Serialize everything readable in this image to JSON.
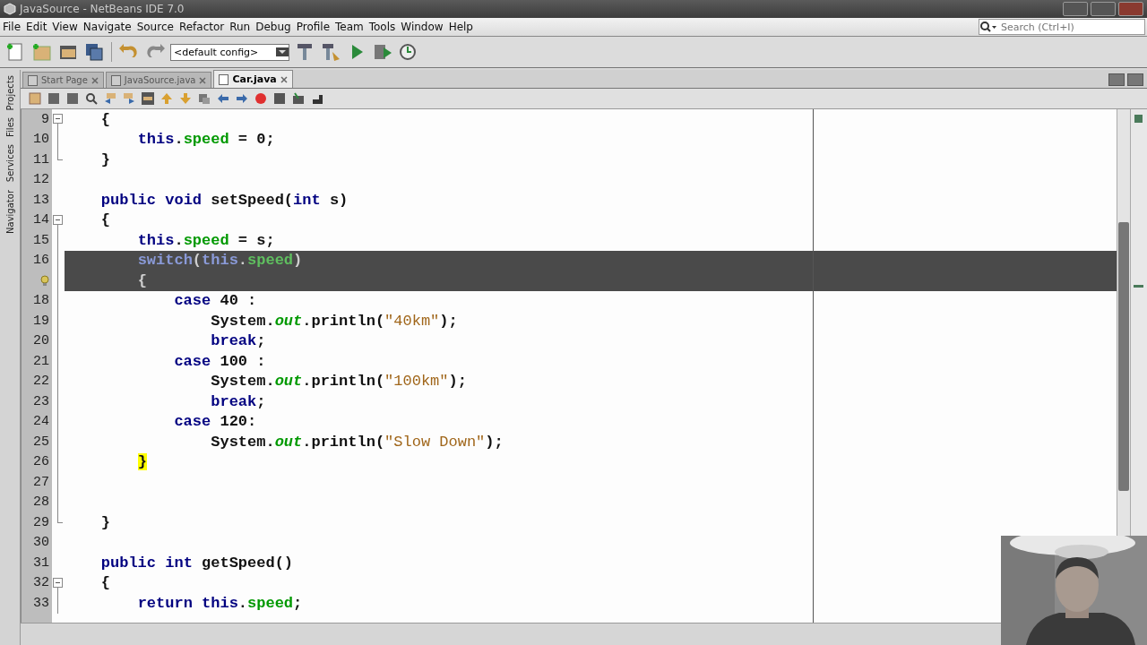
{
  "window": {
    "title": "JavaSource - NetBeans IDE 7.0"
  },
  "menu": [
    "File",
    "Edit",
    "View",
    "Navigate",
    "Source",
    "Refactor",
    "Run",
    "Debug",
    "Profile",
    "Team",
    "Tools",
    "Window",
    "Help"
  ],
  "search": {
    "placeholder": "Search (Ctrl+I)"
  },
  "toolbar": {
    "config": "<default config>"
  },
  "side_tabs": [
    "Projects",
    "Files",
    "Services",
    "Navigator"
  ],
  "editor_tabs": [
    {
      "label": "Start Page",
      "selected": false
    },
    {
      "label": "JavaSource.java",
      "selected": false
    },
    {
      "label": "Car.java",
      "selected": true
    }
  ],
  "code_lines": [
    {
      "number": "9",
      "kind": "fold_start",
      "selected": false,
      "tokens": [
        {
          "text": "    {",
          "kind": "plain"
        }
      ]
    },
    {
      "number": "10",
      "kind": "code",
      "selected": false,
      "tokens": [
        {
          "text": "        this",
          "kind": "keyword"
        },
        {
          "text": ".",
          "kind": "plain"
        },
        {
          "text": "speed",
          "kind": "field"
        },
        {
          "text": " = 0;",
          "kind": "plain"
        }
      ]
    },
    {
      "number": "11",
      "kind": "fold_end",
      "selected": false,
      "tokens": [
        {
          "text": "    }",
          "kind": "plain"
        }
      ]
    },
    {
      "number": "12",
      "kind": "code",
      "selected": false
    },
    {
      "number": "13",
      "kind": "code",
      "selected": false,
      "tokens": [
        {
          "text": "    public",
          "kind": "keyword"
        },
        {
          "text": " void",
          "kind": "keyword"
        },
        {
          "text": " setSpeed(",
          "kind": "plain"
        },
        {
          "text": "int",
          "kind": "keyword"
        },
        {
          "text": " s)",
          "kind": "plain"
        }
      ]
    },
    {
      "number": "14",
      "kind": "fold_start",
      "selected": false,
      "tokens": [
        {
          "text": "    {",
          "kind": "plain"
        }
      ]
    },
    {
      "number": "15",
      "kind": "code",
      "selected": false,
      "tokens": [
        {
          "text": "        this",
          "kind": "keyword"
        },
        {
          "text": ".",
          "kind": "plain"
        },
        {
          "text": "speed",
          "kind": "field"
        },
        {
          "text": " = s;",
          "kind": "plain"
        }
      ]
    },
    {
      "number": "16",
      "kind": "code",
      "selected": true,
      "tokens": [
        {
          "text": "        switch",
          "kind": "keyword"
        },
        {
          "text": "(",
          "kind": "plain"
        },
        {
          "text": "this",
          "kind": "keyword"
        },
        {
          "text": ".",
          "kind": "plain"
        },
        {
          "text": "speed",
          "kind": "field"
        },
        {
          "text": ")",
          "kind": "plain"
        }
      ]
    },
    {
      "kind": "hint",
      "selected": true,
      "tokens": [
        {
          "text": "        {",
          "kind": "plain"
        }
      ]
    },
    {
      "number": "18",
      "kind": "code",
      "selected": false,
      "tokens": [
        {
          "text": "            case",
          "kind": "keyword"
        },
        {
          "text": " 40 :",
          "kind": "plain"
        }
      ]
    },
    {
      "number": "19",
      "kind": "code",
      "selected": false,
      "tokens": [
        {
          "text": "                System.",
          "kind": "plain"
        },
        {
          "text": "out",
          "kind": "static"
        },
        {
          "text": ".println(",
          "kind": "plain"
        },
        {
          "text": "\"40km\"",
          "kind": "string"
        },
        {
          "text": ");",
          "kind": "plain"
        }
      ]
    },
    {
      "number": "20",
      "kind": "code",
      "selected": false,
      "tokens": [
        {
          "text": "                break",
          "kind": "keyword"
        },
        {
          "text": ";",
          "kind": "plain"
        }
      ]
    },
    {
      "number": "21",
      "kind": "code",
      "selected": false,
      "tokens": [
        {
          "text": "            case",
          "kind": "keyword"
        },
        {
          "text": " 100 :",
          "kind": "plain"
        }
      ]
    },
    {
      "number": "22",
      "kind": "code",
      "selected": false,
      "tokens": [
        {
          "text": "                System.",
          "kind": "plain"
        },
        {
          "text": "out",
          "kind": "static"
        },
        {
          "text": ".println(",
          "kind": "plain"
        },
        {
          "text": "\"100km\"",
          "kind": "string"
        },
        {
          "text": ");",
          "kind": "plain"
        }
      ]
    },
    {
      "number": "23",
      "kind": "code",
      "selected": false,
      "tokens": [
        {
          "text": "                break",
          "kind": "keyword"
        },
        {
          "text": ";",
          "kind": "plain"
        }
      ]
    },
    {
      "number": "24",
      "kind": "code",
      "selected": false,
      "tokens": [
        {
          "text": "            case",
          "kind": "keyword"
        },
        {
          "text": " 120:",
          "kind": "plain"
        }
      ]
    },
    {
      "number": "25",
      "kind": "code",
      "selected": false,
      "tokens": [
        {
          "text": "                System.",
          "kind": "plain"
        },
        {
          "text": "out",
          "kind": "static"
        },
        {
          "text": ".println(",
          "kind": "plain"
        },
        {
          "text": "\"Slow Down\"",
          "kind": "string"
        },
        {
          "text": ");",
          "kind": "plain"
        }
      ]
    },
    {
      "number": "26",
      "kind": "code",
      "selected": false,
      "tokens": [
        {
          "text": "        }",
          "kind": "match"
        }
      ]
    },
    {
      "number": "27",
      "kind": "code",
      "selected": false
    },
    {
      "number": "28",
      "kind": "code",
      "selected": false
    },
    {
      "number": "29",
      "kind": "fold_end",
      "selected": false,
      "tokens": [
        {
          "text": "    }",
          "kind": "plain"
        }
      ]
    },
    {
      "number": "30",
      "kind": "code",
      "selected": false
    },
    {
      "number": "31",
      "kind": "code",
      "selected": false,
      "tokens": [
        {
          "text": "    public",
          "kind": "keyword"
        },
        {
          "text": " int",
          "kind": "keyword"
        },
        {
          "text": " getSpeed()",
          "kind": "plain"
        }
      ]
    },
    {
      "number": "32",
      "kind": "fold_start",
      "selected": false,
      "tokens": [
        {
          "text": "    {",
          "kind": "plain"
        }
      ]
    },
    {
      "number": "33",
      "kind": "code",
      "selected": false,
      "tokens": [
        {
          "text": "        return",
          "kind": "keyword"
        },
        {
          "text": " this",
          "kind": "keyword"
        },
        {
          "text": ".",
          "kind": "plain"
        },
        {
          "text": "speed",
          "kind": "field"
        },
        {
          "text": ";",
          "kind": "plain"
        }
      ]
    }
  ],
  "webcam": {
    "kind": "picture"
  }
}
